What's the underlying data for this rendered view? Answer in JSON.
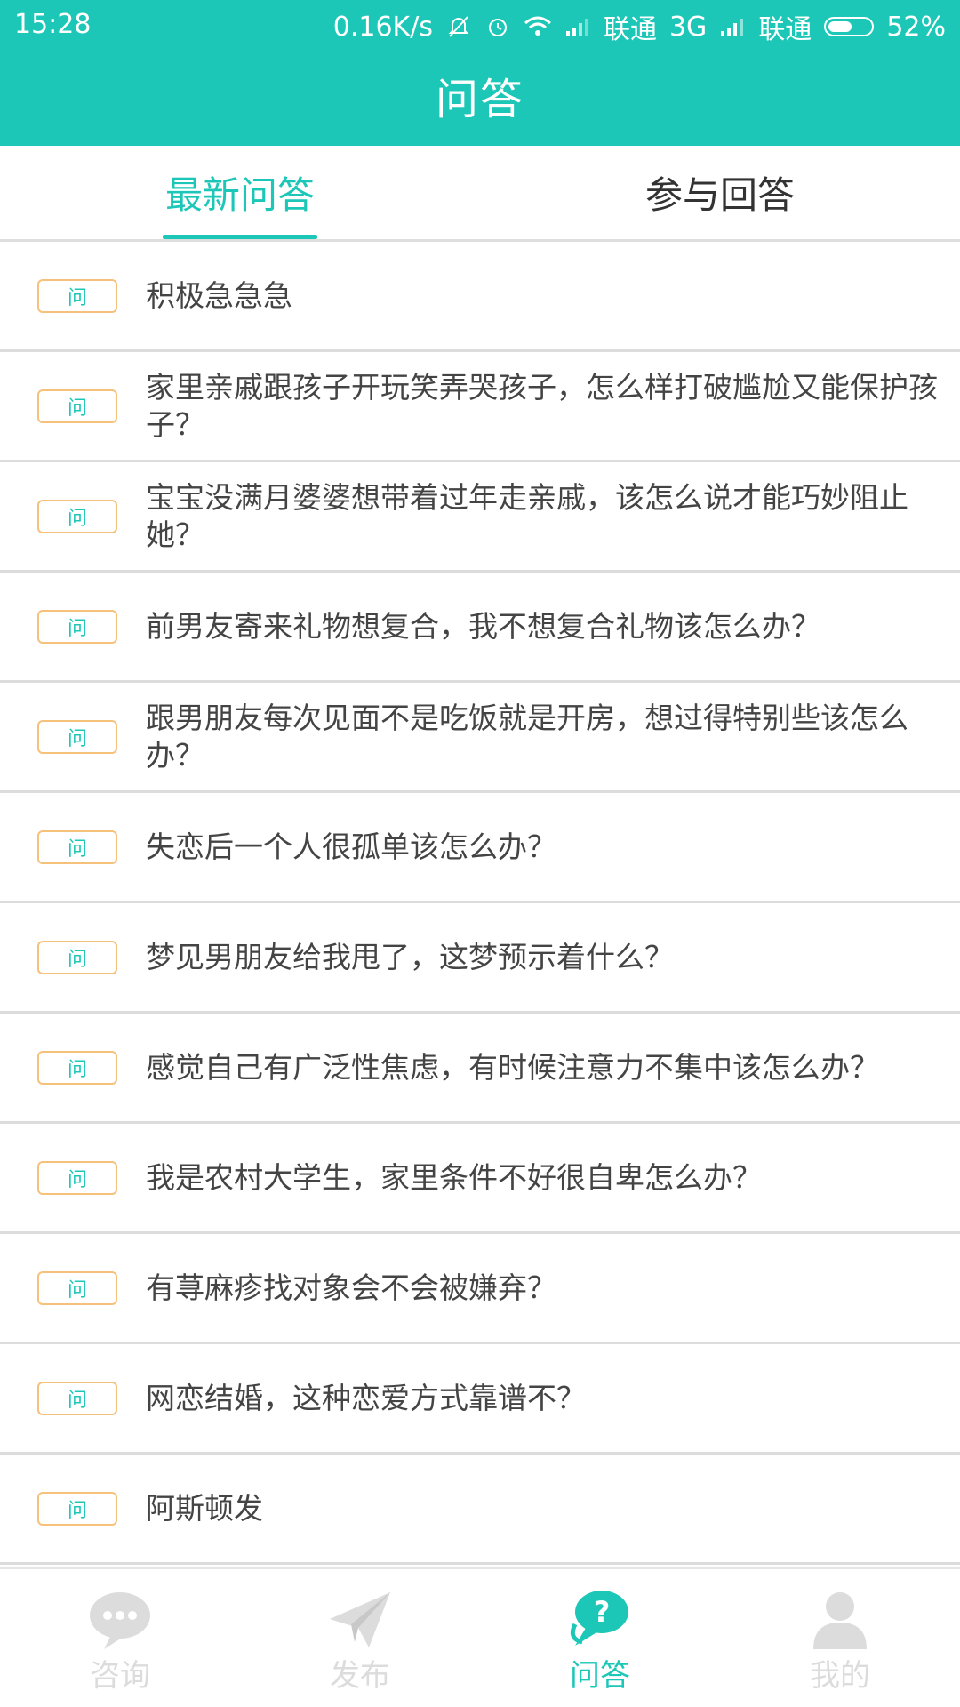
{
  "status_bar": {
    "time": "15:28",
    "speed": "0.16K/s",
    "carrier1": "联通",
    "network1": "3G",
    "carrier2": "联通",
    "battery": "52%"
  },
  "header": {
    "title": "问答"
  },
  "tabs": [
    {
      "label": "最新问答",
      "active": true
    },
    {
      "label": "参与回答",
      "active": false
    }
  ],
  "questions": {
    "badge": "问",
    "items": [
      "积极急急急",
      "家里亲戚跟孩子开玩笑弄哭孩子，怎么样打破尴尬又能保护孩子？",
      "宝宝没满月婆婆想带着过年走亲戚，该怎么说才能巧妙阻止她？",
      "前男友寄来礼物想复合，我不想复合礼物该怎么办？",
      "跟男朋友每次见面不是吃饭就是开房，想过得特别些该怎么办？",
      "失恋后一个人很孤单该怎么办？",
      "梦见男朋友给我甩了，这梦预示着什么？",
      "感觉自己有广泛性焦虑，有时候注意力不集中该怎么办？",
      "我是农村大学生，家里条件不好很自卑怎么办？",
      "有荨麻疹找对象会不会被嫌弃？",
      "网恋结婚，这种恋爱方式靠谱不？",
      "阿斯顿发"
    ]
  },
  "bottom_nav": {
    "items": [
      {
        "label": "咨询",
        "icon": "chat-bubble-icon",
        "active": false
      },
      {
        "label": "发布",
        "icon": "paper-plane-icon",
        "active": false
      },
      {
        "label": "问答",
        "icon": "question-bubble-icon",
        "active": true
      },
      {
        "label": "我的",
        "icon": "person-icon",
        "active": false
      }
    ]
  },
  "colors": {
    "accent": "#1cc7b7",
    "badge_border": "#f6c17a",
    "inactive_nav": "#dcdcdc"
  }
}
